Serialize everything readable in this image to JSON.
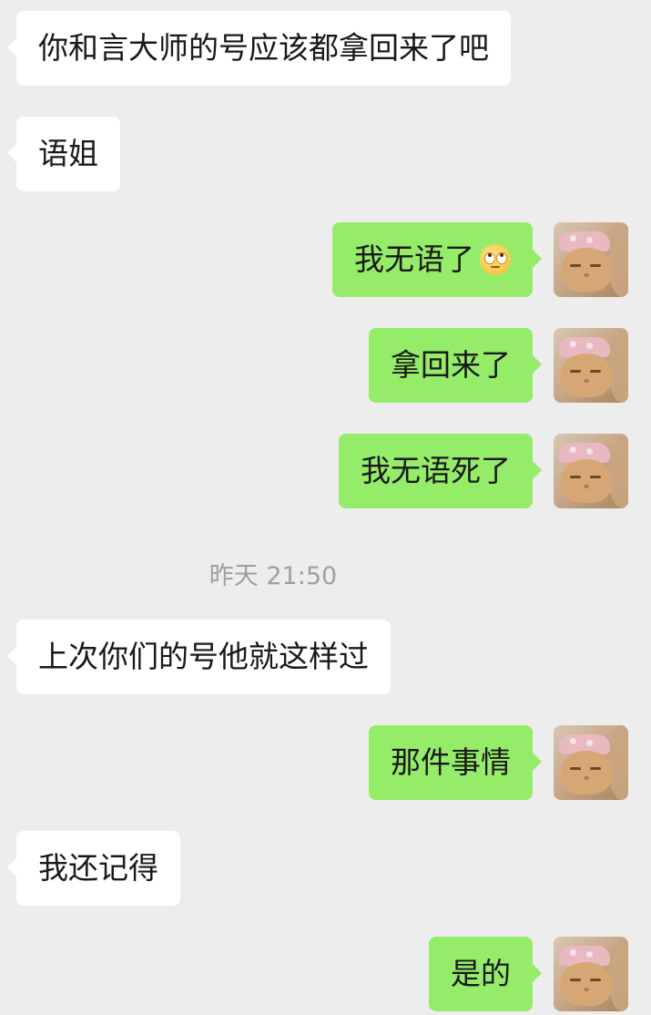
{
  "messages": [
    {
      "side": "left",
      "text": "你和言大师的号应该都拿回来了吧"
    },
    {
      "side": "left",
      "text": "语姐"
    },
    {
      "side": "right",
      "text": "我无语了",
      "emoji": "face-with-rolling-eyes"
    },
    {
      "side": "right",
      "text": "拿回来了"
    },
    {
      "side": "right",
      "text": "我无语死了"
    },
    {
      "side": "left",
      "text": "上次你们的号他就这样过"
    },
    {
      "side": "right",
      "text": "那件事情"
    },
    {
      "side": "left",
      "text": "我还记得"
    },
    {
      "side": "right",
      "text": "是的"
    }
  ],
  "timestamp": "昨天 21:50",
  "colors": {
    "background": "#ededed",
    "incoming_bubble": "#ffffff",
    "outgoing_bubble": "#95ec69",
    "text": "#191919",
    "timestamp": "#9f9f9f"
  },
  "avatar": {
    "icon": "cat-avatar"
  }
}
